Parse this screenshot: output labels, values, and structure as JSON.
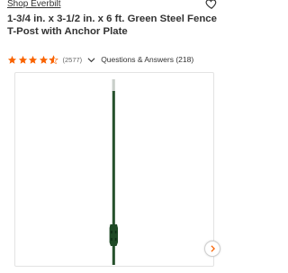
{
  "brand": {
    "link_text": "Shop Everbilt"
  },
  "favorite": {
    "icon": "heart-outline-icon"
  },
  "product": {
    "title": "1-3/4 in. x 3-1/2 in. x 6 ft. Green Steel Fence T-Post with Anchor Plate"
  },
  "rating": {
    "stars": 4.5,
    "star_color": "#f96302",
    "review_count": "(2577)",
    "qa_label": "Questions & Answers (218)"
  },
  "gallery": {
    "image": "green-steel-t-post",
    "next_icon": "chevron-right-icon",
    "accent": "#f96302",
    "post_color": "#1f4a26"
  }
}
